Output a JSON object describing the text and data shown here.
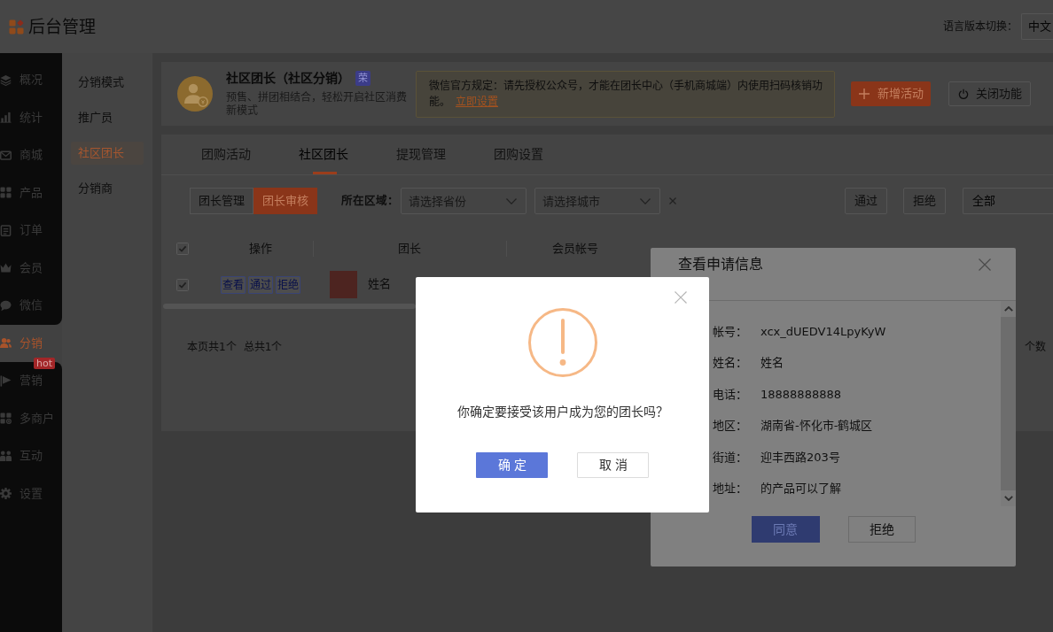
{
  "header": {
    "title": "后台管理",
    "language_label": "语言版本切换：",
    "language": {
      "value": "中文"
    }
  },
  "sidebar": {
    "items": [
      {
        "label": "概况",
        "selected": false
      },
      {
        "label": "统计",
        "selected": false
      },
      {
        "label": "商城",
        "selected": false
      },
      {
        "label": "产品",
        "selected": false
      },
      {
        "label": "订单",
        "selected": false
      },
      {
        "label": "会员",
        "selected": false
      },
      {
        "label": "微信",
        "selected": false
      },
      {
        "label": "分销",
        "selected": true
      },
      {
        "label": "营销",
        "selected": false,
        "badge": "hot"
      },
      {
        "label": "多商户",
        "selected": false
      },
      {
        "label": "互动",
        "selected": false
      },
      {
        "label": "设置",
        "selected": false
      }
    ]
  },
  "submenu": {
    "items": [
      {
        "label": "分销模式",
        "selected": false
      },
      {
        "label": "推广员",
        "selected": false
      },
      {
        "label": "社区团长",
        "selected": true
      },
      {
        "label": "分销商",
        "selected": false
      }
    ]
  },
  "feature": {
    "title": "社区团长（社区分销）",
    "tag": "荣",
    "description": "预售、拼团相结合，轻松开启社区消费新模式",
    "notice": {
      "text": "微信官方规定：请先授权公众号，才能在团长中心（手机商城端）内使用扫码核销功能。",
      "link": "立即设置"
    },
    "buttons": [
      {
        "label": "新增活动",
        "kind": "add"
      },
      {
        "label": "关闭功能",
        "kind": "power"
      }
    ]
  },
  "tabs": [
    {
      "label": "团购活动",
      "selected": false
    },
    {
      "label": "社区团长",
      "selected": true
    },
    {
      "label": "提现管理",
      "selected": false
    },
    {
      "label": "团购设置",
      "selected": false
    }
  ],
  "filters": {
    "views": [
      {
        "label": "团长管理",
        "selected": false
      },
      {
        "label": "团长审核",
        "selected": true
      }
    ],
    "region_label": "所在区域：",
    "province": {
      "placeholder": "请选择省份"
    },
    "city": {
      "placeholder": "请选择城市"
    },
    "actions": [
      "通过",
      "拒绝"
    ],
    "status": {
      "value": "全部"
    }
  },
  "table": {
    "select_all": {
      "checked": true
    },
    "columns": [
      "操作",
      "团长",
      "会员帐号"
    ],
    "rows": [
      {
        "checked": true,
        "actions": [
          "查看",
          "通过",
          "拒绝"
        ],
        "name": "姓名"
      }
    ]
  },
  "footer": {
    "page_count": "本页共1个",
    "total_count": "总共1个",
    "page_size_label": "个数"
  },
  "application_dialog": {
    "title": "查看申请信息",
    "fields": [
      {
        "label": "帐号：",
        "value": "xcx_dUEDV14LpyKyW"
      },
      {
        "label": "姓名：",
        "value": "姓名"
      },
      {
        "label": "电话：",
        "value": "18888888888"
      },
      {
        "label": "地区：",
        "value": "湖南省-怀化市-鹤城区"
      },
      {
        "label": "街道：",
        "value": "迎丰西路203号"
      },
      {
        "label": "地址：",
        "value": "的产品可以了解"
      }
    ],
    "buttons": [
      {
        "label": "同意",
        "kind": "primary"
      },
      {
        "label": "拒绝",
        "kind": "default"
      }
    ]
  },
  "confirm_dialog": {
    "message": "你确定要接受该用户成为您的团长吗？",
    "buttons": [
      {
        "label": "确定",
        "kind": "primary"
      },
      {
        "label": "取消",
        "kind": "default"
      }
    ]
  }
}
